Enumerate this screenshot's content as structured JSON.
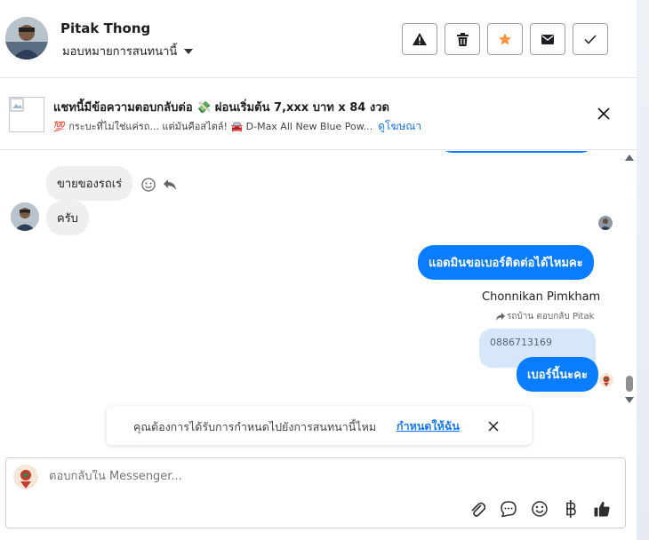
{
  "header": {
    "name": "Pitak Thong",
    "assign_label": "มอบหมายการสนทนานี้"
  },
  "ad": {
    "title": "แชทนี้มีข้อความตอบกลับต่อ 💸 ผ่อนเริ่มต้น 7,xxx บาท x 84 งวด",
    "subtitle": "💯 กระบะที่ไม่ใช่แค่รถ... แต่มันคือสไตล์! 🚘 D-Max All New Blue Pow...",
    "link": "ดูโฆษณา"
  },
  "messages": {
    "incoming_1": "ขายของรถเร่",
    "incoming_2": "ครับ",
    "outgoing_1": "แอดมินขอเบอร์ติดต่อได้ไหมคะ",
    "agent_name": "Chonnikan Pimkham",
    "reply_note": "รถบ้าน ตอบกลับ Pitak",
    "quoted_text": "0886713169",
    "outgoing_2": "เบอร์นี้นะคะ"
  },
  "notice": {
    "text": "คุณต้องการได้รับการกำหนดไปยังการสนทนานี้ไหม",
    "link": "กำหนดให้ฉัน"
  },
  "composer": {
    "placeholder": "ตอบกลับใน Messenger..."
  },
  "colors": {
    "accent": "#0a7cff",
    "link": "#1877f2",
    "star": "#f7923a"
  }
}
